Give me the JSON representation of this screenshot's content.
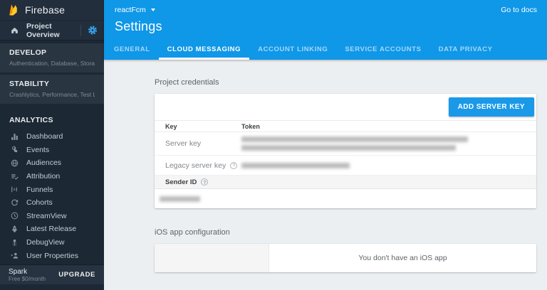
{
  "brand": {
    "name": "Firebase"
  },
  "sidebar": {
    "project_overview": "Project Overview",
    "sections": [
      {
        "title": "DEVELOP",
        "subtitle": "Authentication, Database, Storage, H…"
      },
      {
        "title": "STABILITY",
        "subtitle": "Crashlytics, Performance, Test Lab"
      }
    ],
    "analytics_title": "ANALYTICS",
    "items": [
      {
        "icon": "dashboard-icon",
        "label": "Dashboard"
      },
      {
        "icon": "touch-app-icon",
        "label": "Events"
      },
      {
        "icon": "globe-icon",
        "label": "Audiences"
      },
      {
        "icon": "playlist-check-icon",
        "label": "Attribution"
      },
      {
        "icon": "funnel-bars-icon",
        "label": "Funnels"
      },
      {
        "icon": "refresh-icon",
        "label": "Cohorts"
      },
      {
        "icon": "clock-icon",
        "label": "StreamView"
      },
      {
        "icon": "rocket-icon",
        "label": "Latest Release"
      },
      {
        "icon": "bug-icon",
        "label": "DebugView"
      },
      {
        "icon": "people-arrow-icon",
        "label": "User Properties"
      }
    ],
    "plan": {
      "name": "Spark",
      "price": "Free $0/month",
      "upgrade": "UPGRADE"
    }
  },
  "header": {
    "project": "reactFcm",
    "docs_link": "Go to docs",
    "title": "Settings"
  },
  "tabs": [
    {
      "label": "GENERAL",
      "active": false
    },
    {
      "label": "CLOUD MESSAGING",
      "active": true
    },
    {
      "label": "ACCOUNT LINKING",
      "active": false
    },
    {
      "label": "SERVICE ACCOUNTS",
      "active": false
    },
    {
      "label": "DATA PRIVACY",
      "active": false
    }
  ],
  "credentials": {
    "heading": "Project credentials",
    "add_button": "ADD SERVER KEY",
    "col_key": "Key",
    "col_token": "Token",
    "row_server_key": "Server key",
    "row_legacy_key": "Legacy server key",
    "sender_id": "Sender ID",
    "help": "?"
  },
  "ios": {
    "heading": "iOS app configuration",
    "empty": "You don't have an iOS app"
  },
  "colors": {
    "accent_blue": "#0f97e8",
    "button_blue": "#1a99e9",
    "sidebar_bg": "#1c2834",
    "content_bg": "#eceff1",
    "flame_yellow": "#ffca28",
    "flame_orange": "#ffa000"
  }
}
